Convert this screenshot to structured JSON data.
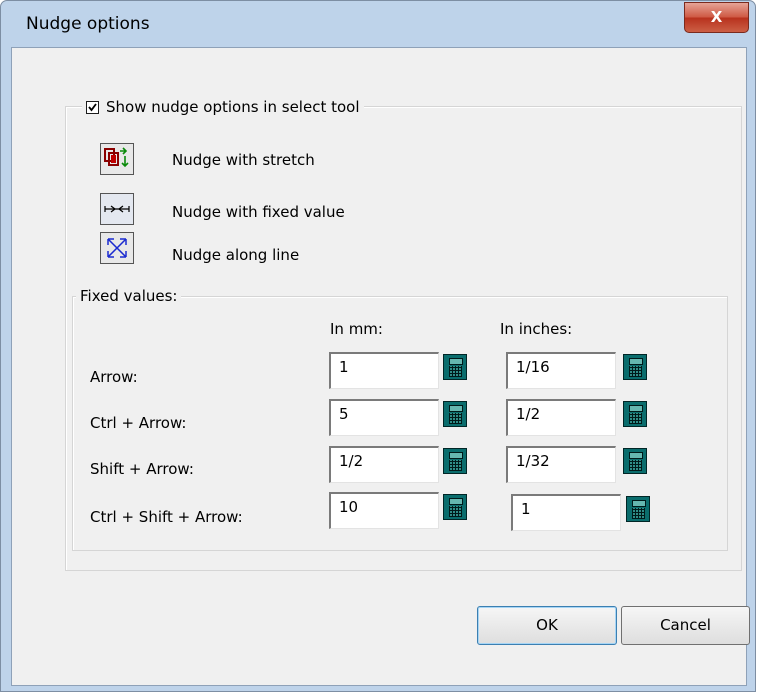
{
  "window": {
    "title": "Nudge options",
    "close_label": "X"
  },
  "nudge_group": {
    "checkbox_label": "Show nudge options in select tool",
    "checked": true,
    "options": [
      {
        "icon": "stretch-icon",
        "label": "Nudge with stretch"
      },
      {
        "icon": "fixed-value-icon",
        "label": "Nudge with fixed value"
      },
      {
        "icon": "along-line-icon",
        "label": "Nudge along line"
      }
    ]
  },
  "fixed_values": {
    "legend": "Fixed values:",
    "col_mm": "In mm:",
    "col_inches": "In inches:",
    "rows": [
      {
        "label": "Arrow:",
        "mm": "1",
        "inches": "1/16"
      },
      {
        "label": "Ctrl + Arrow:",
        "mm": "5",
        "inches": "1/2"
      },
      {
        "label": "Shift + Arrow:",
        "mm": "1/2",
        "inches": "1/32"
      },
      {
        "label": "Ctrl + Shift + Arrow:",
        "mm": "10",
        "inches": "1"
      }
    ]
  },
  "buttons": {
    "ok": "OK",
    "cancel": "Cancel"
  },
  "colors": {
    "calculator": "#0a6d6d",
    "title_bar": "#bed3ea",
    "close_button": "#c8452f"
  }
}
